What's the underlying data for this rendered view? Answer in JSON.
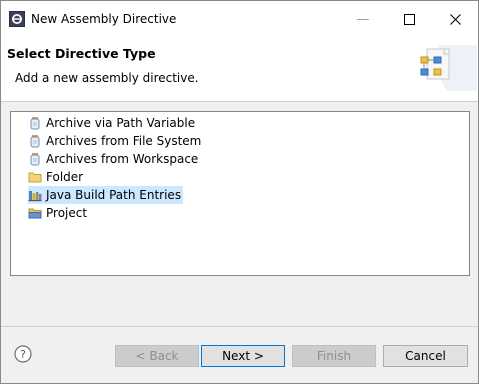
{
  "window": {
    "title": "New Assembly Directive",
    "minimize_glyph": "—",
    "maximize_glyph": "☐",
    "close_glyph": "✕"
  },
  "header": {
    "title": "Select Directive Type",
    "description": "Add a new assembly directive."
  },
  "list": {
    "items": [
      {
        "label": "Archive via Path Variable",
        "icon": "jar-icon"
      },
      {
        "label": "Archives from File System",
        "icon": "jar-icon"
      },
      {
        "label": "Archives from Workspace",
        "icon": "jar-icon"
      },
      {
        "label": "Folder",
        "icon": "folder-icon"
      },
      {
        "label": "Java Build Path Entries",
        "icon": "library-icon",
        "selected": true
      },
      {
        "label": "Project",
        "icon": "project-folder-icon"
      }
    ]
  },
  "buttons": {
    "back": "< Back",
    "next": "Next >",
    "finish": "Finish",
    "cancel": "Cancel"
  },
  "colors": {
    "selection": "#cce8ff",
    "default_button_border": "#0078d7"
  }
}
